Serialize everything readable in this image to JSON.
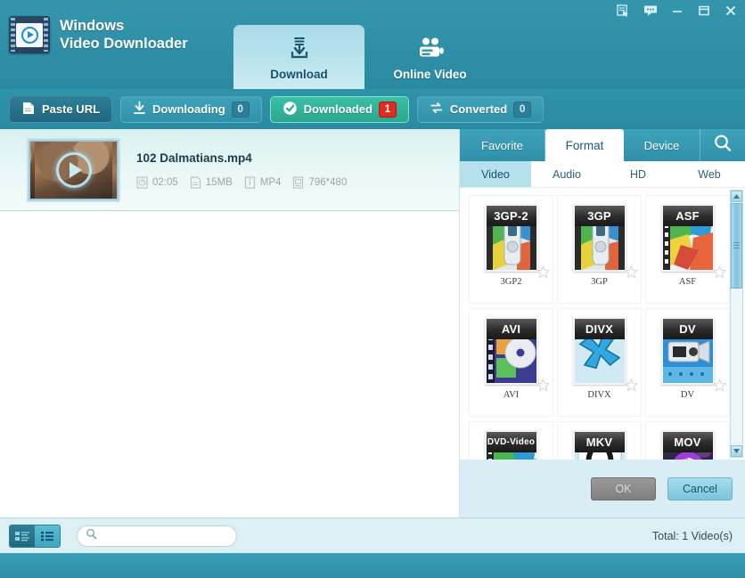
{
  "window": {
    "app_name_line1": "Windows",
    "app_name_line2": "Video Downloader",
    "controls": [
      {
        "name": "register-icon",
        "title": "Register"
      },
      {
        "name": "feedback-icon",
        "title": "Feedback"
      },
      {
        "name": "minimize-icon",
        "title": "Minimize"
      },
      {
        "name": "maximize-icon",
        "title": "Maximize"
      },
      {
        "name": "close-icon",
        "title": "Close"
      }
    ]
  },
  "main_tabs": [
    {
      "label": "Download",
      "icon": "download-icon",
      "active": true
    },
    {
      "label": "Online Video",
      "icon": "online-video-icon",
      "active": false
    }
  ],
  "toolbar": {
    "paste_url_label": "Paste URL",
    "buttons": [
      {
        "label": "Downloading",
        "count": "0",
        "state": "normal",
        "icon": "download-arrow-icon"
      },
      {
        "label": "Downloaded",
        "count": "1",
        "state": "selected",
        "icon": "check-circle-icon"
      },
      {
        "label": "Converted",
        "count": "0",
        "state": "normal",
        "icon": "convert-icon"
      }
    ]
  },
  "video_list": {
    "items": [
      {
        "name": "102 Dalmatians.mp4",
        "duration": "02:05",
        "size": "15MB",
        "format": "MP4",
        "resolution": "796*480"
      }
    ]
  },
  "right_panel": {
    "tabs": [
      {
        "label": "Favorite",
        "active": false
      },
      {
        "label": "Format",
        "active": true
      },
      {
        "label": "Device",
        "active": false
      }
    ],
    "search_icon": "search-icon",
    "sub_tabs": [
      {
        "label": "Video",
        "active": true
      },
      {
        "label": "Audio",
        "active": false
      },
      {
        "label": "HD",
        "active": false
      },
      {
        "label": "Web",
        "active": false
      }
    ],
    "formats": [
      {
        "badge": "3GP-2",
        "name": "3GP2",
        "art": "phone"
      },
      {
        "badge": "3GP",
        "name": "3GP",
        "art": "phone"
      },
      {
        "badge": "ASF",
        "name": "ASF",
        "art": "film"
      },
      {
        "badge": "AVI",
        "name": "AVI",
        "art": "disc"
      },
      {
        "badge": "DIVX",
        "name": "DIVX",
        "art": "x"
      },
      {
        "badge": "DV",
        "name": "DV",
        "art": "camcorder"
      },
      {
        "badge": "DVD-Video",
        "name": "",
        "art": "film"
      },
      {
        "badge": "MKV",
        "name": "",
        "art": "ring"
      },
      {
        "badge": "MOV",
        "name": "",
        "art": "swirl"
      }
    ],
    "ok_label": "OK",
    "cancel_label": "Cancel"
  },
  "status_bar": {
    "view_modes": [
      {
        "name": "detail-view",
        "active": false
      },
      {
        "name": "list-view",
        "active": true
      }
    ],
    "search_placeholder": "",
    "search_value": "",
    "total_label": "Total: 1 Video(s)"
  },
  "colors": {
    "brand_teal": "#2e93a9",
    "accent_light": "#bce4ee",
    "badge_red": "#e02b20",
    "selected_green": "#3bbfa6",
    "panel_bg": "#d9eef4"
  }
}
